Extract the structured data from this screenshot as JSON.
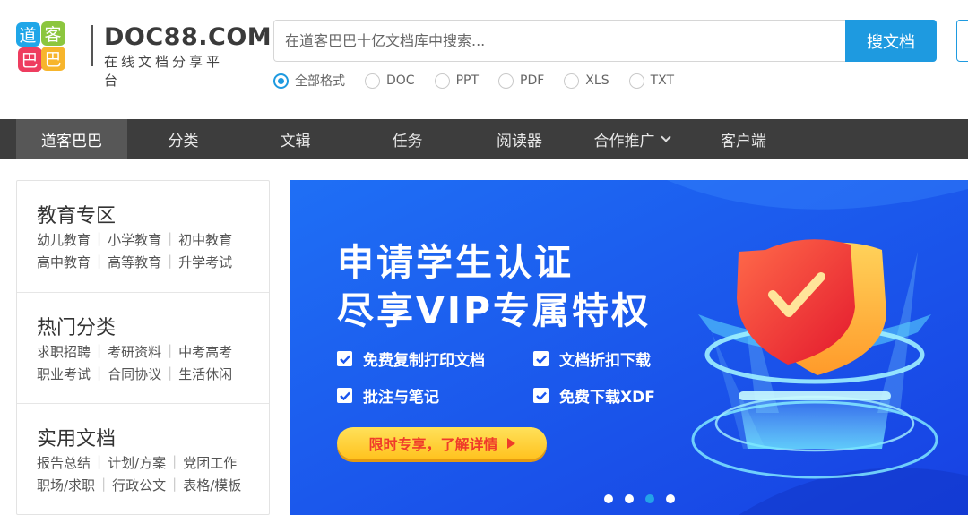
{
  "logo": {
    "badge_chars": [
      "道",
      "客",
      "巴",
      "巴"
    ],
    "domain": "DOC88.COM",
    "tagline": "在线文档分享平台"
  },
  "search": {
    "placeholder": "在道客巴巴十亿文档库中搜索...",
    "button_label": "搜文档",
    "formats": [
      {
        "label": "全部格式",
        "checked": true
      },
      {
        "label": "DOC",
        "checked": false
      },
      {
        "label": "PPT",
        "checked": false
      },
      {
        "label": "PDF",
        "checked": false
      },
      {
        "label": "XLS",
        "checked": false
      },
      {
        "label": "TXT",
        "checked": false
      }
    ]
  },
  "nav": {
    "items": [
      "道客巴巴",
      "分类",
      "文辑",
      "任务",
      "阅读器",
      "合作推广",
      "客户端"
    ],
    "active_index": 0
  },
  "sidebar": {
    "sections": [
      {
        "title": "教育专区",
        "rows": [
          [
            "幼儿教育",
            "小学教育",
            "初中教育"
          ],
          [
            "高中教育",
            "高等教育",
            "升学考试"
          ]
        ]
      },
      {
        "title": "热门分类",
        "rows": [
          [
            "求职招聘",
            "考研资料",
            "中考高考"
          ],
          [
            "职业考试",
            "合同协议",
            "生活休闲"
          ]
        ]
      },
      {
        "title": "实用文档",
        "rows": [
          [
            "报告总结",
            "计划/方案",
            "党团工作"
          ],
          [
            "职场/求职",
            "行政公文",
            "表格/模板"
          ]
        ]
      }
    ]
  },
  "banner": {
    "title_line1": "申请学生认证",
    "title_line2": "尽享VIP专属特权",
    "features": [
      "免费复制打印文档",
      "文档折扣下载",
      "批注与笔记",
      "免费下载XDF"
    ],
    "cta_label": "限时专享，了解详情",
    "slide_count": 4,
    "active_slide": 2
  },
  "colors": {
    "accent": "#1e9ae0",
    "nav_bg": "#3d3d3d",
    "banner_bg": "#1a55ee",
    "cta_text": "#ef3b2a"
  }
}
